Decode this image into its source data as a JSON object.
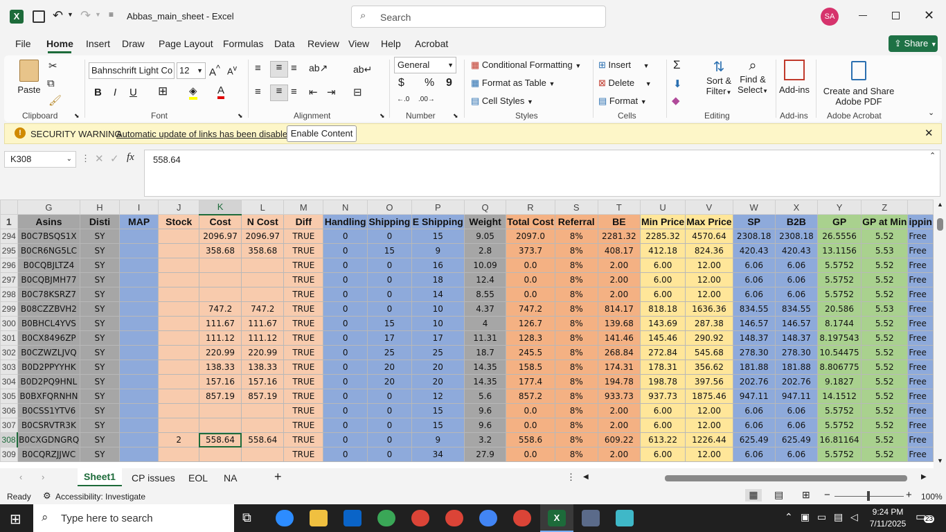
{
  "title_bar": {
    "doc_title": "Abbas_main_sheet  -  Excel",
    "search_placeholder": "Search",
    "user_initials": "SA"
  },
  "menu": {
    "tabs": [
      "File",
      "Home",
      "Insert",
      "Draw",
      "Page Layout",
      "Formulas",
      "Data",
      "Review",
      "View",
      "Help",
      "Acrobat"
    ],
    "share_label": "Share"
  },
  "ribbon": {
    "clipboard": {
      "paste": "Paste",
      "group": "Clipboard"
    },
    "font": {
      "family": "Bahnschrift Light Co",
      "size": "12",
      "group": "Font",
      "bold": "B",
      "italic": "I",
      "underline": "U"
    },
    "alignment": {
      "group": "Alignment"
    },
    "number": {
      "format": "General",
      "group": "Number",
      "percent": "%",
      "comma": "9",
      "dollar": "$"
    },
    "styles": {
      "cond": "Conditional Formatting",
      "table": "Format as Table",
      "cell": "Cell Styles",
      "group": "Styles"
    },
    "cells": {
      "insert": "Insert",
      "delete": "Delete",
      "format": "Format",
      "group": "Cells"
    },
    "editing": {
      "sort": "Sort &",
      "filter": "Filter",
      "find": "Find &",
      "select": "Select",
      "group": "Editing",
      "sigma": "Σ"
    },
    "addins": {
      "label": "Add-ins",
      "group": "Add-ins"
    },
    "acrobat": {
      "label1": "Create and Share",
      "label2": "Adobe PDF",
      "group": "Adobe Acrobat"
    }
  },
  "warning": {
    "title": "SECURITY WARNING",
    "message": "Automatic update of links has been disabled",
    "button": "Enable Content"
  },
  "formula_bar": {
    "name_box": "K308",
    "fx": "fx",
    "value": "558.64"
  },
  "sheet": {
    "columns": [
      "G",
      "H",
      "I",
      "J",
      "K",
      "L",
      "M",
      "N",
      "O",
      "P",
      "Q",
      "R",
      "S",
      "T",
      "U",
      "V",
      "W",
      "X",
      "Y",
      "Z"
    ],
    "selected_column": "K",
    "header_row_num": "1",
    "headers": [
      "Asins",
      "Disti",
      "MAP",
      "Stock",
      "Cost",
      "N Cost",
      "Diff",
      "Handling",
      "Shipping",
      "E Shipping",
      "Weight",
      "Total Cost",
      "Referral",
      "BE",
      "Min Price",
      "Max Price",
      "SP",
      "B2B",
      "GP",
      "GP at Min",
      "ippin"
    ],
    "col_colors": [
      "cg",
      "cg",
      "cb",
      "cp",
      "cp",
      "cp",
      "cp",
      "cb",
      "cb",
      "cb",
      "cg",
      "co",
      "co",
      "co",
      "cy",
      "cy",
      "cb",
      "cb",
      "cgr",
      "cgr",
      "cb"
    ],
    "selected_row": "308",
    "rows": [
      {
        "n": "294",
        "c": [
          "B0C7BSQS1X",
          "SY",
          "",
          "",
          "2096.97",
          "2096.97",
          "TRUE",
          "0",
          "0",
          "15",
          "9.05",
          "2097.0",
          "8%",
          "2281.32",
          "2285.32",
          "4570.64",
          "2308.18",
          "2308.18",
          "26.5556",
          "5.52",
          "Free"
        ]
      },
      {
        "n": "295",
        "c": [
          "B0CR6NG5LC",
          "SY",
          "",
          "",
          "358.68",
          "358.68",
          "TRUE",
          "0",
          "15",
          "9",
          "2.8",
          "373.7",
          "8%",
          "408.17",
          "412.18",
          "824.36",
          "420.43",
          "420.43",
          "13.1156",
          "5.53",
          "Free"
        ]
      },
      {
        "n": "296",
        "c": [
          "B0CQBJLTZ4",
          "SY",
          "",
          "",
          "",
          "",
          "TRUE",
          "0",
          "0",
          "16",
          "10.09",
          "0.0",
          "8%",
          "2.00",
          "6.00",
          "12.00",
          "6.06",
          "6.06",
          "5.5752",
          "5.52",
          "Free"
        ]
      },
      {
        "n": "297",
        "c": [
          "B0CQBJMH77",
          "SY",
          "",
          "",
          "",
          "",
          "TRUE",
          "0",
          "0",
          "18",
          "12.4",
          "0.0",
          "8%",
          "2.00",
          "6.00",
          "12.00",
          "6.06",
          "6.06",
          "5.5752",
          "5.52",
          "Free"
        ]
      },
      {
        "n": "298",
        "c": [
          "B0C78KSRZ7",
          "SY",
          "",
          "",
          "",
          "",
          "TRUE",
          "0",
          "0",
          "14",
          "8.55",
          "0.0",
          "8%",
          "2.00",
          "6.00",
          "12.00",
          "6.06",
          "6.06",
          "5.5752",
          "5.52",
          "Free"
        ]
      },
      {
        "n": "299",
        "c": [
          "B08CZZBVH2",
          "SY",
          "",
          "",
          "747.2",
          "747.2",
          "TRUE",
          "0",
          "0",
          "10",
          "4.37",
          "747.2",
          "8%",
          "814.17",
          "818.18",
          "1636.36",
          "834.55",
          "834.55",
          "20.586",
          "5.53",
          "Free"
        ]
      },
      {
        "n": "300",
        "c": [
          "B0BHCL4YVS",
          "SY",
          "",
          "",
          "111.67",
          "111.67",
          "TRUE",
          "0",
          "15",
          "10",
          "4",
          "126.7",
          "8%",
          "139.68",
          "143.69",
          "287.38",
          "146.57",
          "146.57",
          "8.1744",
          "5.52",
          "Free"
        ]
      },
      {
        "n": "301",
        "c": [
          "B0CX8496ZP",
          "SY",
          "",
          "",
          "111.12",
          "111.12",
          "TRUE",
          "0",
          "17",
          "17",
          "11.31",
          "128.3",
          "8%",
          "141.46",
          "145.46",
          "290.92",
          "148.37",
          "148.37",
          "8.197543",
          "5.52",
          "Free"
        ]
      },
      {
        "n": "302",
        "c": [
          "B0CZWZLJVQ",
          "SY",
          "",
          "",
          "220.99",
          "220.99",
          "TRUE",
          "0",
          "25",
          "25",
          "18.7",
          "245.5",
          "8%",
          "268.84",
          "272.84",
          "545.68",
          "278.30",
          "278.30",
          "10.54475",
          "5.52",
          "Free"
        ]
      },
      {
        "n": "303",
        "c": [
          "B0D2PPYYHK",
          "SY",
          "",
          "",
          "138.33",
          "138.33",
          "TRUE",
          "0",
          "20",
          "20",
          "14.35",
          "158.5",
          "8%",
          "174.31",
          "178.31",
          "356.62",
          "181.88",
          "181.88",
          "8.806775",
          "5.52",
          "Free"
        ]
      },
      {
        "n": "304",
        "c": [
          "B0D2PQ9HNL",
          "SY",
          "",
          "",
          "157.16",
          "157.16",
          "TRUE",
          "0",
          "20",
          "20",
          "14.35",
          "177.4",
          "8%",
          "194.78",
          "198.78",
          "397.56",
          "202.76",
          "202.76",
          "9.1827",
          "5.52",
          "Free"
        ]
      },
      {
        "n": "305",
        "c": [
          "B0BXFQRNHN",
          "SY",
          "",
          "",
          "857.19",
          "857.19",
          "TRUE",
          "0",
          "0",
          "12",
          "5.6",
          "857.2",
          "8%",
          "933.73",
          "937.73",
          "1875.46",
          "947.11",
          "947.11",
          "14.1512",
          "5.52",
          "Free"
        ]
      },
      {
        "n": "306",
        "c": [
          "B0CSS1YTV6",
          "SY",
          "",
          "",
          "",
          "",
          "TRUE",
          "0",
          "0",
          "15",
          "9.6",
          "0.0",
          "8%",
          "2.00",
          "6.00",
          "12.00",
          "6.06",
          "6.06",
          "5.5752",
          "5.52",
          "Free"
        ]
      },
      {
        "n": "307",
        "c": [
          "B0CSRVTR3K",
          "SY",
          "",
          "",
          "",
          "",
          "TRUE",
          "0",
          "0",
          "15",
          "9.6",
          "0.0",
          "8%",
          "2.00",
          "6.00",
          "12.00",
          "6.06",
          "6.06",
          "5.5752",
          "5.52",
          "Free"
        ]
      },
      {
        "n": "308",
        "c": [
          "B0CXGDNGRQ",
          "SY",
          "",
          "2",
          "558.64",
          "558.64",
          "TRUE",
          "0",
          "0",
          "9",
          "3.2",
          "558.6",
          "8%",
          "609.22",
          "613.22",
          "1226.44",
          "625.49",
          "625.49",
          "16.81164",
          "5.52",
          "Free"
        ]
      },
      {
        "n": "309",
        "c": [
          "B0CQRZJJWC",
          "SY",
          "",
          "",
          "",
          "",
          "TRUE",
          "0",
          "0",
          "34",
          "27.9",
          "0.0",
          "8%",
          "2.00",
          "6.00",
          "12.00",
          "6.06",
          "6.06",
          "5.5752",
          "5.52",
          "Free"
        ]
      }
    ]
  },
  "sheet_tabs": [
    "Sheet1",
    "CP issues",
    "EOL",
    "NA"
  ],
  "active_sheet": "Sheet1",
  "status_bar": {
    "ready": "Ready",
    "accessibility": "Accessibility: Investigate",
    "zoom": "100%"
  },
  "taskbar": {
    "search_placeholder": "Type here to search",
    "time": "9:24 PM",
    "date": "7/11/2025",
    "notif_count": "23"
  },
  "colors": {
    "excel_green": "#1d6b3a",
    "share_button": "#1e7145",
    "warning_bg": "#fdf6c8"
  }
}
